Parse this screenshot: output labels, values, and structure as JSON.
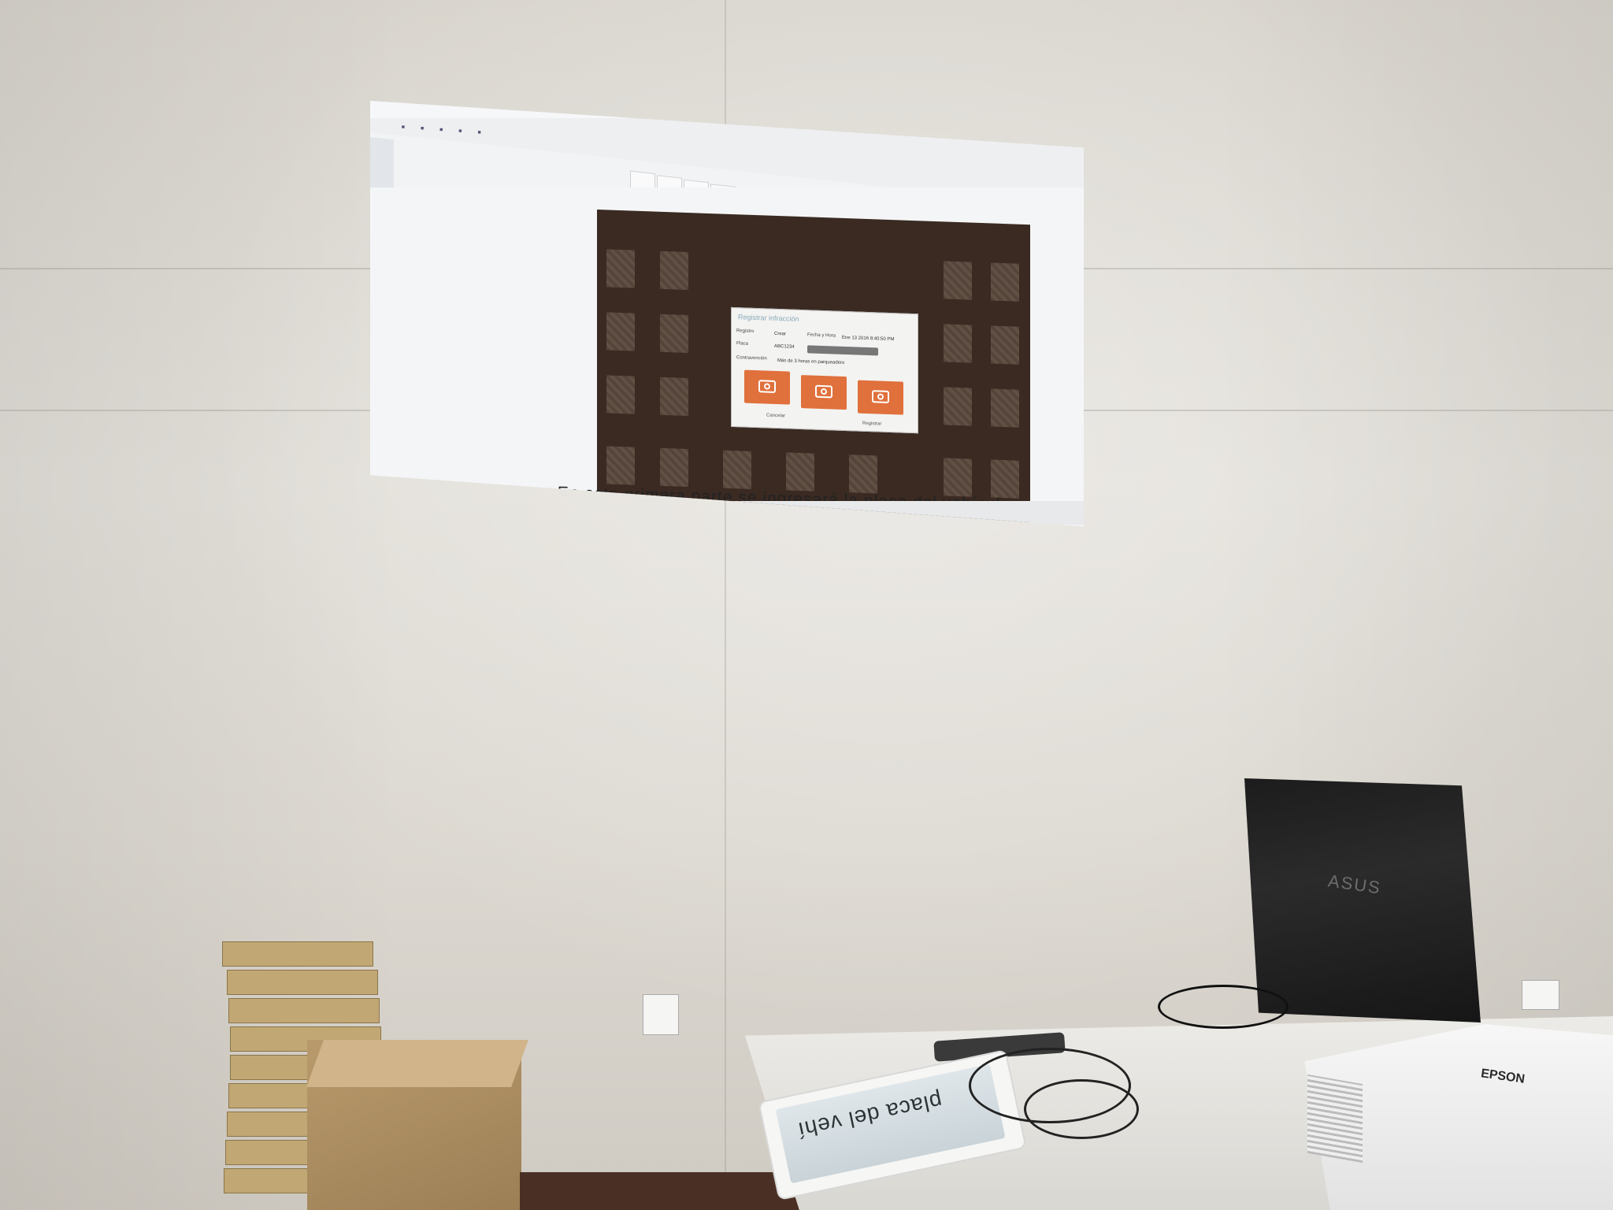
{
  "scene": {
    "description_free": true
  },
  "projection": {
    "caption": "En esta primera parte se ingresará la placa del vehículo y se especificar",
    "ribbon_title": "",
    "dialog": {
      "title": "Registrar infracción",
      "labels": [
        "Registro",
        "Placa",
        "Fecha y Hora",
        "Contravención"
      ],
      "values": [
        "Crear",
        "ABC1234",
        "Ene 13 2016 8:40:50 PM",
        "Más de 3 horas en parqueadero"
      ],
      "actions": [
        "Cancelar",
        "Registrar"
      ]
    }
  },
  "tablet": {
    "mirrored_text": "placa del vehí"
  },
  "laptop": {
    "brand": "ASUS"
  },
  "projector": {
    "brand": "EPSON"
  }
}
